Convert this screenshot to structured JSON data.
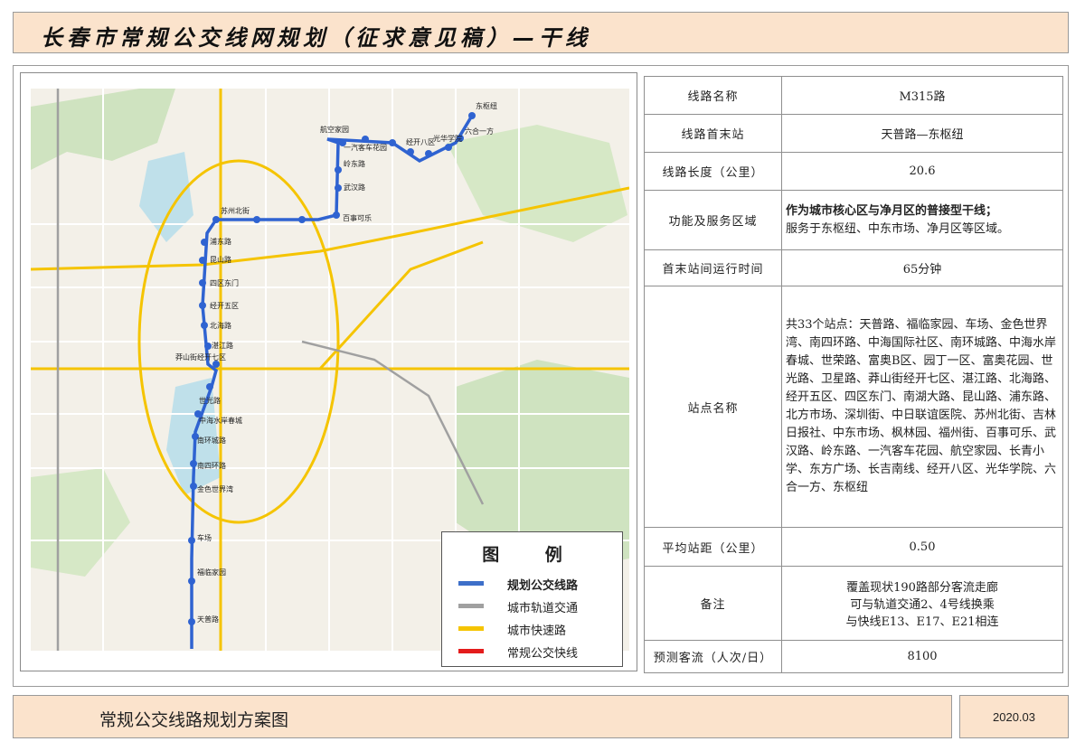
{
  "title": "长春市常规公交线网规划（征求意见稿）—干线",
  "bottom": {
    "left_title": "常规公交线路规划方案图",
    "date": "2020.03"
  },
  "legend": {
    "title": "图 例",
    "items": [
      {
        "label": "规划公交线路",
        "color": "#3d6fc9"
      },
      {
        "label": "城市轨道交通",
        "color": "#a0a0a0"
      },
      {
        "label": "城市快速路",
        "color": "#f5c400"
      },
      {
        "label": "常规公交快线",
        "color": "#e41c1c"
      }
    ]
  },
  "info": {
    "route_name_label": "线路名称",
    "route_name": "M315路",
    "terminals_label": "线路首末站",
    "terminals": "天普路—东枢纽",
    "length_label": "线路长度（公里）",
    "length": "20.6",
    "function_label": "功能及服务区域",
    "function_bold": "作为城市核心区与净月区的普接型干线；",
    "function_text": "服务于东枢纽、中东市场、净月区等区域。",
    "runtime_label": "首末站间运行时间",
    "runtime": "65分钟",
    "stations_label": "站点名称",
    "stations_text": "共33个站点：天普路、福临家园、车场、金色世界湾、南四环路、中海国际社区、南环城路、中海水岸春城、世荣路、富奥B区、园丁一区、富奥花园、世光路、卫星路、莽山街经开七区、湛江路、北海路、经开五区、四区东门、南湖大路、昆山路、浦东路、北方市场、深圳街、中日联谊医院、苏州北街、吉林日报社、中东市场、枫林园、福州街、百事可乐、武汉路、岭东路、一汽客车花园、航空家园、长青小学、东方广场、长吉南线、经开八区、光华学院、六合一方、东枢纽",
    "spacing_label": "平均站距（公里）",
    "spacing": "0.50",
    "remarks_label": "备注",
    "remarks_1": "覆盖现状190路部分客流走廊",
    "remarks_2": "可与轨道交通2、4号线换乘",
    "remarks_3": "与快线E13、E17、E21相连",
    "ridership_label": "预测客流（人次/日）",
    "ridership": "8100"
  },
  "map_labels": {
    "s1": "东枢纽",
    "s2": "六合一方",
    "s3": "光华学院",
    "s4": "经开八区",
    "s5": "长吉南线",
    "s6": "东方广场",
    "s7": "长青小学",
    "s8": "航空家园",
    "s9": "一汽客车花园",
    "s10": "岭东路",
    "s11": "武汉路",
    "s12": "百事可乐",
    "s13": "苏州北街",
    "s14": "中东市场",
    "s15": "深圳街",
    "s16": "浦东路",
    "s17": "昆山路",
    "s18": "南湖大路",
    "s19": "四区东门",
    "s20": "经开五区",
    "s21": "北海路",
    "s22": "湛江路",
    "s23": "莽山街经开七区",
    "s24": "卫星路",
    "s25": "园丁一区",
    "s26": "世光路",
    "s27": "世荣路",
    "s28": "中海水岸春城",
    "s29": "南环城路",
    "s30": "南四环路",
    "s31": "金色世界湾",
    "s32": "车场",
    "s33": "福临家园",
    "s34": "天普路"
  }
}
